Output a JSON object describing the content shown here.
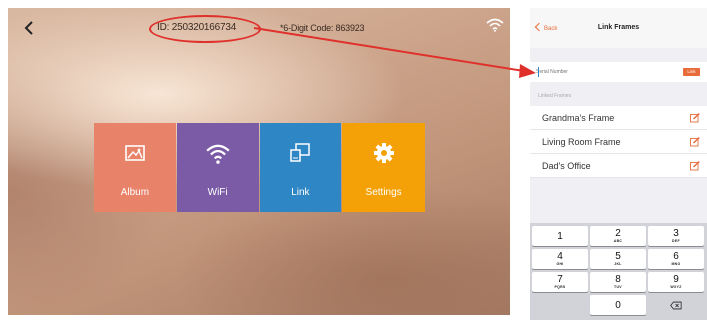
{
  "frame": {
    "device_id": "ID: 250320166734",
    "six_digit_code": "*6-Digit Code: 863923",
    "tiles": [
      {
        "label": "Album",
        "icon": "photo-icon",
        "color": "#e8836a"
      },
      {
        "label": "WiFi",
        "icon": "wifi-icon",
        "color": "#7b5aa6"
      },
      {
        "label": "Link",
        "icon": "link-devices-icon",
        "color": "#2f86c5"
      },
      {
        "label": "Settings",
        "icon": "gear-icon",
        "color": "#f3a106"
      }
    ]
  },
  "phone": {
    "back_label": "Back",
    "title": "Link Frames",
    "input_placeholder": "Serial Number",
    "link_button": "Link",
    "section_header": "Linked Frames",
    "linked_frames": [
      {
        "name": "Grandma's Frame"
      },
      {
        "name": "Living Room Frame"
      },
      {
        "name": "Dad's Office"
      }
    ],
    "keypad": [
      {
        "digit": "1",
        "letters": ""
      },
      {
        "digit": "2",
        "letters": "ABC"
      },
      {
        "digit": "3",
        "letters": "DEF"
      },
      {
        "digit": "4",
        "letters": "GHI"
      },
      {
        "digit": "5",
        "letters": "JKL"
      },
      {
        "digit": "6",
        "letters": "MNO"
      },
      {
        "digit": "7",
        "letters": "PQRS"
      },
      {
        "digit": "8",
        "letters": "TUV"
      },
      {
        "digit": "9",
        "letters": "WXYZ"
      },
      {
        "digit": "0",
        "letters": ""
      }
    ]
  },
  "colors": {
    "accent_orange": "#e86b3a",
    "annotation_red": "#e0302b"
  }
}
